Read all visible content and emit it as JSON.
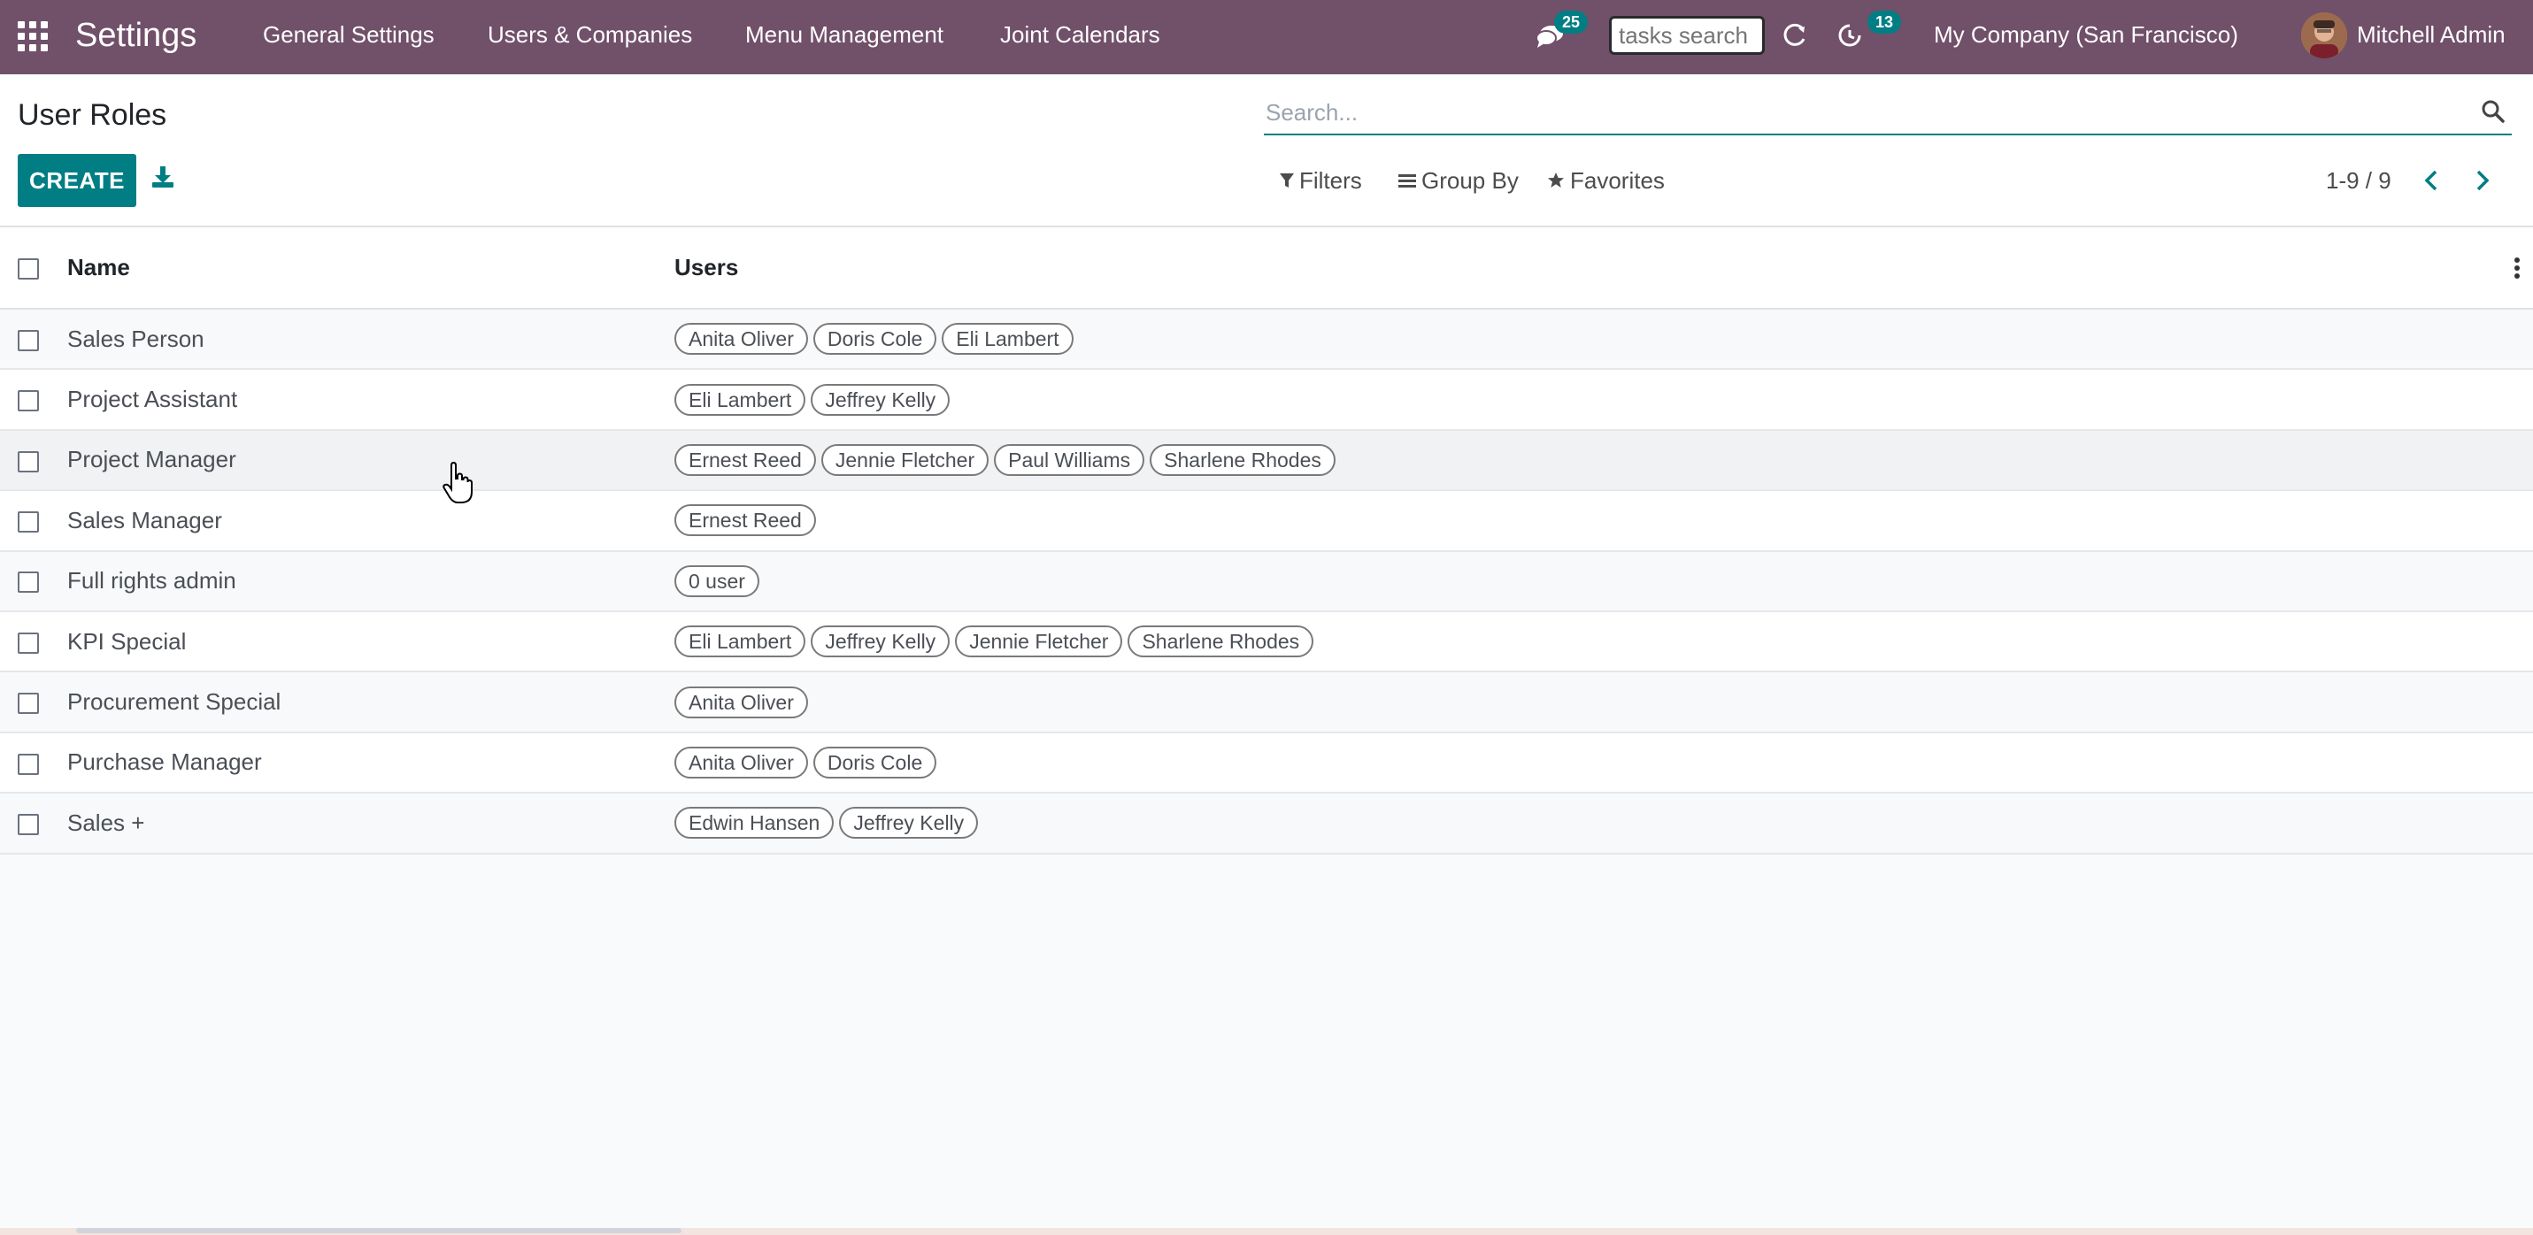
{
  "navbar": {
    "app_title": "Settings",
    "menus": [
      "General Settings",
      "Users & Companies",
      "Menu Management",
      "Joint Calendars"
    ],
    "messages_badge": "25",
    "tasks_search_placeholder": "tasks search",
    "activities_badge": "13",
    "company": "My Company (San Francisco)",
    "user_name": "Mitchell Admin"
  },
  "control_panel": {
    "title": "User Roles",
    "search_placeholder": "Search...",
    "create_label": "CREATE",
    "filters_label": "Filters",
    "group_by_label": "Group By",
    "favorites_label": "Favorites",
    "pager": "1-9 / 9"
  },
  "list": {
    "columns": {
      "name": "Name",
      "users": "Users"
    },
    "rows": [
      {
        "name": "Sales Person",
        "users": [
          "Anita Oliver",
          "Doris Cole",
          "Eli Lambert"
        ]
      },
      {
        "name": "Project Assistant",
        "users": [
          "Eli Lambert",
          "Jeffrey Kelly"
        ]
      },
      {
        "name": "Project Manager",
        "users": [
          "Ernest Reed",
          "Jennie Fletcher",
          "Paul Williams",
          "Sharlene Rhodes"
        ]
      },
      {
        "name": "Sales Manager",
        "users": [
          "Ernest Reed"
        ]
      },
      {
        "name": "Full rights admin",
        "users": [
          "0 user"
        ]
      },
      {
        "name": "KPI Special",
        "users": [
          "Eli Lambert",
          "Jeffrey Kelly",
          "Jennie Fletcher",
          "Sharlene Rhodes"
        ]
      },
      {
        "name": "Procurement Special",
        "users": [
          "Anita Oliver"
        ]
      },
      {
        "name": "Purchase Manager",
        "users": [
          "Anita Oliver",
          "Doris Cole"
        ]
      },
      {
        "name": "Sales +",
        "users": [
          "Edwin Hansen",
          "Jeffrey Kelly"
        ]
      }
    ]
  },
  "colors": {
    "navbar": "#71506a",
    "primary": "#017e84",
    "text": "#212529"
  },
  "icons": [
    "apps-grid-icon",
    "chat-icon",
    "refresh-icon",
    "clock-icon",
    "search-icon",
    "download-icon",
    "filter-icon",
    "group-by-icon",
    "star-icon",
    "chevron-left-icon",
    "chevron-right-icon",
    "vertical-dots-icon"
  ]
}
